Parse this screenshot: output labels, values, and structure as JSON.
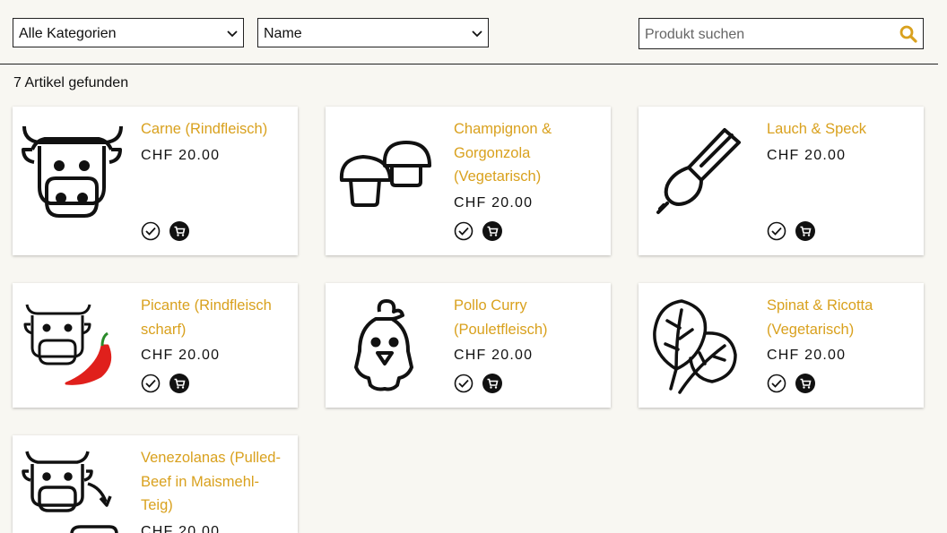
{
  "filters": {
    "category_value": "Alle Kategorien",
    "sort_value": "Name",
    "search_placeholder": "Produkt suchen"
  },
  "result_count": "7 Artikel gefunden",
  "accent_color": "#d9a11e",
  "products": [
    {
      "name": "Carne (Rindfleisch)",
      "price": "CHF 20.00",
      "icon": "cow-icon"
    },
    {
      "name": "Champignon & Gorgonzola (Vegetarisch)",
      "price": "CHF 20.00",
      "icon": "mushroom-icon"
    },
    {
      "name": "Lauch & Speck",
      "price": "CHF 20.00",
      "icon": "leek-icon"
    },
    {
      "name": "Picante (Rindfleisch scharf)",
      "price": "CHF 20.00",
      "icon": "cow-chili-icon"
    },
    {
      "name": "Pollo Curry (Pouletfleisch)",
      "price": "CHF 20.00",
      "icon": "chicken-icon"
    },
    {
      "name": "Spinat & Ricotta (Vegetarisch)",
      "price": "CHF 20.00",
      "icon": "spinach-icon"
    },
    {
      "name": "Venezolanas (Pulled-Beef in Maismehl-Teig)",
      "price": "CHF 20.00",
      "icon": "cow-pulled-beef-icon"
    }
  ]
}
